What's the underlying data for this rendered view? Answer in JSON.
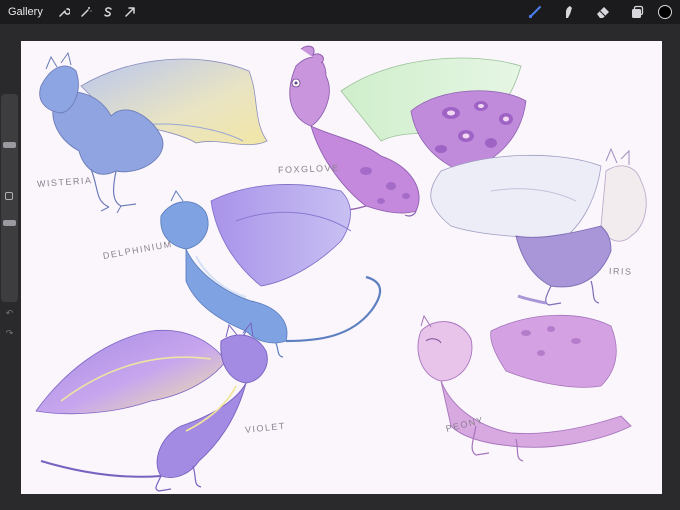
{
  "topbar": {
    "gallery_label": "Gallery",
    "left_tools": [
      "wrench-icon",
      "magic-wand-icon",
      "selection-s-icon",
      "transform-arrow-icon"
    ],
    "right_tools": [
      "brush-icon",
      "smudge-icon",
      "eraser-icon",
      "layers-icon"
    ],
    "brush_accent": "#4a7ef0",
    "current_color": "#000000"
  },
  "canvas": {
    "background": "#faf6fb",
    "dragons": [
      {
        "name": "WISTERIA",
        "color": "#8fa4e0",
        "wing": "#c6d2ee"
      },
      {
        "name": "FOXGLOVE",
        "color": "#c489dd",
        "wing": "#d9eed8"
      },
      {
        "name": "DELPHINIUM",
        "color": "#7fa3e2",
        "wing": "#b7a4ee"
      },
      {
        "name": "IRIS",
        "color": "#a896d8",
        "wing": "#eeeef6"
      },
      {
        "name": "VIOLET",
        "color": "#a38be3",
        "wing": "#b794ee"
      },
      {
        "name": "PEONY",
        "color": "#d7a9e0",
        "wing": "#d4a2e2"
      }
    ]
  }
}
